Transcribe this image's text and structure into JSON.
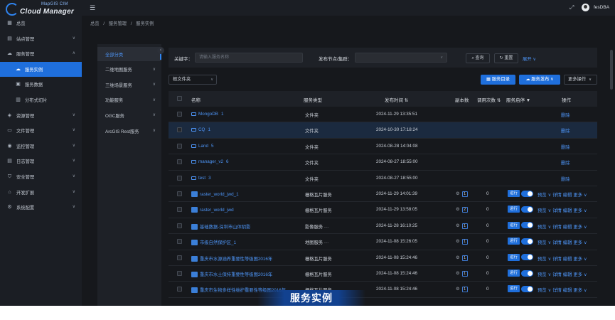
{
  "brand": {
    "line1": "MapGIS CIM",
    "line2": "Cloud Manager"
  },
  "user": {
    "name": "fesDBA"
  },
  "nav": [
    {
      "label": "总览",
      "icon": "grid-icon",
      "has_arrow": false,
      "sub": false,
      "active": false
    },
    {
      "label": "站点管理",
      "icon": "server-icon",
      "has_arrow": true,
      "sub": false,
      "active": false
    },
    {
      "label": "服务管理",
      "icon": "cloud-icon",
      "has_arrow": true,
      "sub": false,
      "active": false,
      "expanded": true
    },
    {
      "label": "服务实例",
      "icon": "cloud-sub-icon",
      "has_arrow": false,
      "sub": true,
      "active": true
    },
    {
      "label": "服务数据",
      "icon": "database-icon",
      "has_arrow": false,
      "sub": true,
      "active": false
    },
    {
      "label": "分布式切片",
      "icon": "slice-icon",
      "has_arrow": false,
      "sub": true,
      "active": false
    },
    {
      "label": "资源管理",
      "icon": "resource-icon",
      "has_arrow": true,
      "sub": false,
      "active": false
    },
    {
      "label": "文件管理",
      "icon": "folder-icon",
      "has_arrow": true,
      "sub": false,
      "active": false
    },
    {
      "label": "监控管理",
      "icon": "monitor-icon",
      "has_arrow": true,
      "sub": false,
      "active": false
    },
    {
      "label": "日志管理",
      "icon": "log-icon",
      "has_arrow": true,
      "sub": false,
      "active": false
    },
    {
      "label": "安全管理",
      "icon": "shield-icon",
      "has_arrow": true,
      "sub": false,
      "active": false
    },
    {
      "label": "开发扩展",
      "icon": "code-icon",
      "has_arrow": true,
      "sub": false,
      "active": false
    },
    {
      "label": "系统配置",
      "icon": "gear-icon",
      "has_arrow": true,
      "sub": false,
      "active": false
    }
  ],
  "breadcrumb": [
    "总览",
    "/",
    "服务管理",
    "/",
    "服务实例"
  ],
  "categories": [
    {
      "label": "全部分类",
      "active": true,
      "arrow": false
    },
    {
      "label": "二维地图服务",
      "active": false,
      "arrow": true
    },
    {
      "label": "三维场景服务",
      "active": false,
      "arrow": true
    },
    {
      "label": "功能服务",
      "active": false,
      "arrow": true
    },
    {
      "label": "OGC服务",
      "active": false,
      "arrow": true
    },
    {
      "label": "ArcGIS Rest服务",
      "active": false,
      "arrow": true
    }
  ],
  "filter": {
    "keyword_label": "关键字：",
    "keyword_placeholder": "请输入服务名称",
    "node_label": "发布节点/集群：",
    "query_label": "查询",
    "reset_label": "重置",
    "expand_label": "展开"
  },
  "toolbar": {
    "root_select": "根文件夹",
    "catalog_label": "服务目录",
    "publish_label": "服务发布",
    "more_label": "更多操作"
  },
  "columns": {
    "name": "名称",
    "type": "服务类型",
    "time": "发布时间",
    "copies": "副本数",
    "calls": "调用次数",
    "status": "服务启停",
    "ops": "操作"
  },
  "rows": [
    {
      "kind": "folder",
      "name": "MongoDB",
      "count": "1",
      "type": "文件夹",
      "time": "2024-11-29 13:35:51",
      "highlight": false,
      "del": "删除"
    },
    {
      "kind": "folder",
      "name": "CQ",
      "count": "1",
      "type": "文件夹",
      "time": "2024-10-30 17:18:24",
      "highlight": true,
      "del": "删除"
    },
    {
      "kind": "folder",
      "name": "Land",
      "count": "5",
      "type": "文件夹",
      "time": "2024-08-28 14:04:08",
      "highlight": false,
      "del": "删除"
    },
    {
      "kind": "folder",
      "name": "manager_v2",
      "count": "6",
      "type": "文件夹",
      "time": "2024-08-27 18:55:00",
      "highlight": false,
      "del": "删除"
    },
    {
      "kind": "folder",
      "name": "test",
      "count": "3",
      "type": "文件夹",
      "time": "2024-08-27 18:55:00",
      "highlight": false,
      "del": "删除"
    },
    {
      "kind": "layer",
      "name": "raster_world_jwd_1",
      "type": "栅格瓦片服务",
      "time": "2024-11-29 14:01:39",
      "copies": "1",
      "calls": "0",
      "status": "运行"
    },
    {
      "kind": "layer",
      "name": "raster_world_jwd",
      "type": "栅格瓦片服务",
      "time": "2024-11-29 13:58:05",
      "copies": "2",
      "calls": "0",
      "status": "运行"
    },
    {
      "kind": "layer",
      "name": "基础数据-深圳市山体阴影",
      "type": "影像服务 ···",
      "time": "2024-11-28 16:10:25",
      "copies": "1",
      "calls": "0",
      "status": "运行"
    },
    {
      "kind": "layer",
      "name": "市级自然保护区_1",
      "type": "地图服务 ···",
      "time": "2024-11-08 15:26:05",
      "copies": "1",
      "calls": "0",
      "status": "运行"
    },
    {
      "kind": "layer",
      "name": "重庆市水源涵养重要性等级图2016年",
      "type": "栅格瓦片服务",
      "time": "2024-11-08 15:24:46",
      "copies": "1",
      "calls": "0",
      "status": "运行"
    },
    {
      "kind": "layer",
      "name": "重庆市水土保持重要性等级图2016年",
      "type": "栅格瓦片服务",
      "time": "2024-11-08 15:24:46",
      "copies": "1",
      "calls": "0",
      "status": "运行"
    },
    {
      "kind": "layer",
      "name": "重庆市生物多样性维护重要性等级图2016年",
      "type": "栅格瓦片服务",
      "time": "2024-11-08 15:24:46",
      "copies": "1",
      "calls": "0",
      "status": "运行"
    }
  ],
  "row_ops": {
    "preview": "预览",
    "detail": "详情",
    "edit": "编辑",
    "more": "更多"
  },
  "banner": "服务实例",
  "colors": {
    "accent": "#1f6fdc",
    "link": "#4d94f5",
    "bg": "#16181c",
    "panel": "#1e2127"
  }
}
